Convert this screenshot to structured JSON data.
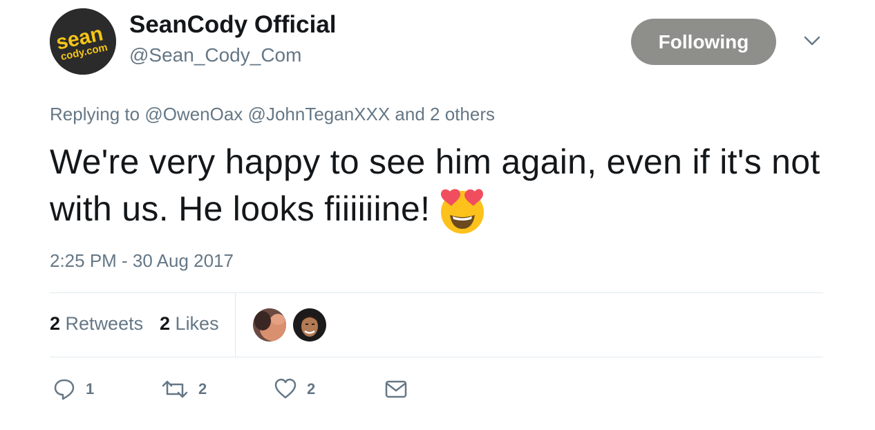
{
  "account": {
    "display_name": "SeanCody Official",
    "handle": "@Sean_Cody_Com",
    "avatar_text_1": "sean",
    "avatar_text_2": "cody.com"
  },
  "follow_button": {
    "label": "Following"
  },
  "reply_context": {
    "prefix": "Replying to",
    "mentions": [
      "@OwenOax",
      "@JohnTeganXXX"
    ],
    "suffix": "and 2 others"
  },
  "tweet": {
    "text": "We're very happy to see him again, even if it's not with us. He looks fiiiiiine!",
    "emoji": "smiling-face-with-heart-eyes",
    "timestamp": "2:25 PM - 30 Aug 2017"
  },
  "stats": {
    "retweets_count": "2",
    "retweets_label": "Retweets",
    "likes_count": "2",
    "likes_label": "Likes"
  },
  "actions": {
    "reply_count": "1",
    "retweet_count": "2",
    "like_count": "2"
  },
  "colors": {
    "text": "#14171a",
    "secondary": "#657786",
    "following_button": "#8e8e8a",
    "avatar_logo": "#f5c518",
    "divider": "#e1e8ed"
  }
}
